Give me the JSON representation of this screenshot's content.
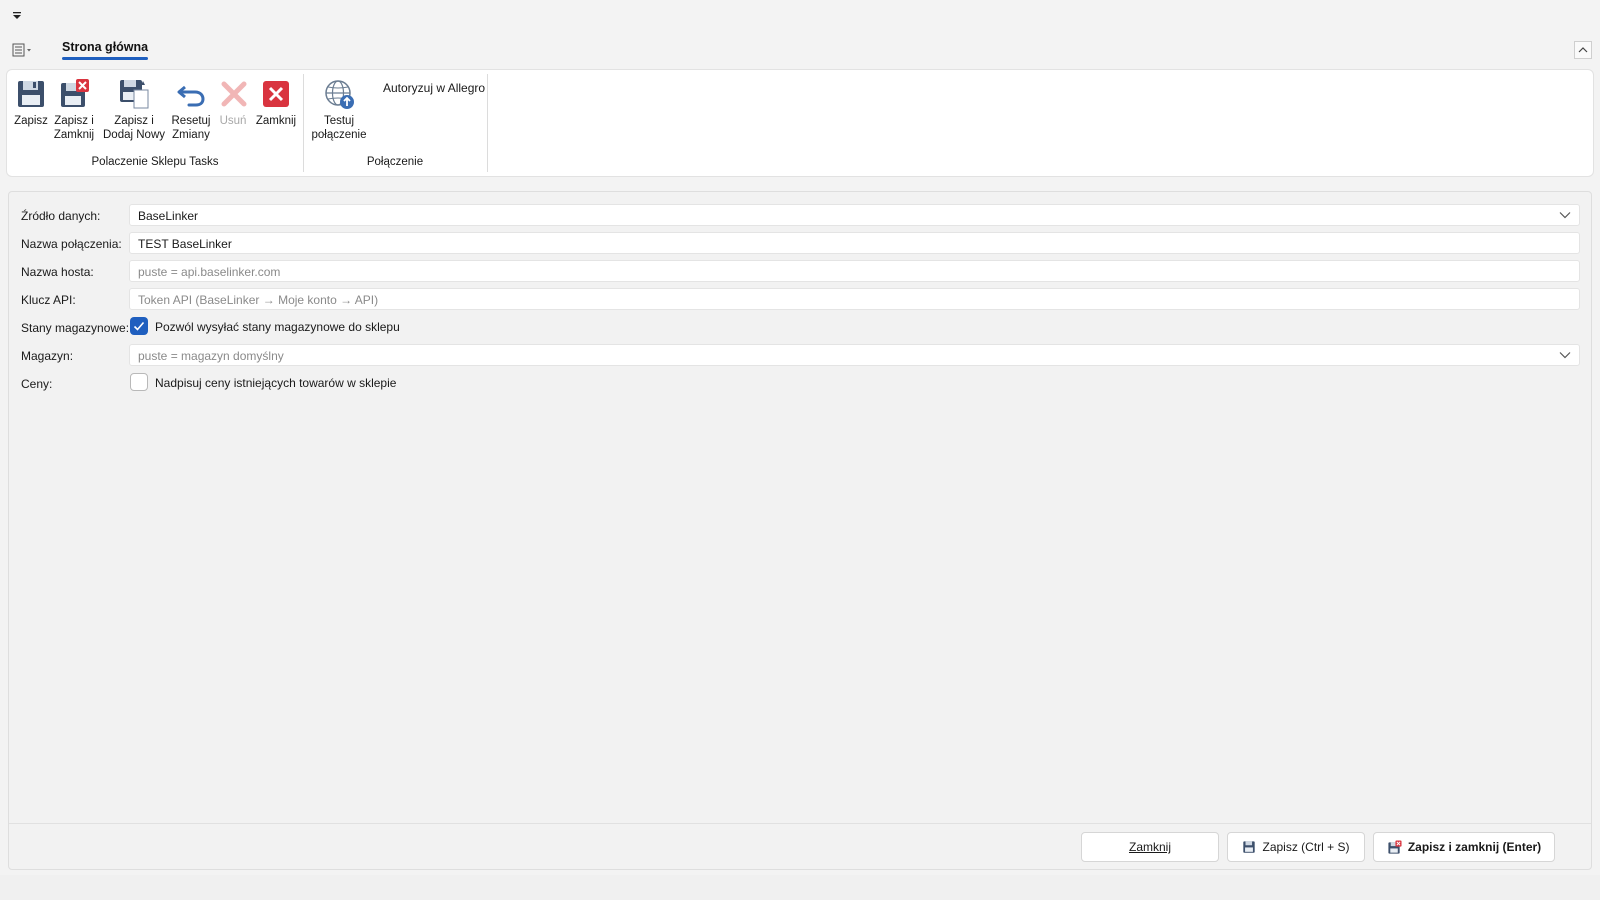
{
  "quick_access": {
    "icon": "dropdown-arrow-icon"
  },
  "ribbon": {
    "menu_icon": "list-menu-icon",
    "active_tab": "Strona główna",
    "groups": [
      {
        "label": "Polaczenie Sklepu Tasks",
        "buttons": [
          {
            "label": "Zapisz",
            "icon": "floppy-icon",
            "enabled": true
          },
          {
            "label": "Zapisz i\nZamknij",
            "icon": "floppy-close-icon",
            "enabled": true
          },
          {
            "label": "Zapisz i\nDodaj Nowy",
            "icon": "floppy-new-icon",
            "enabled": true
          },
          {
            "label": "Resetuj\nZmiany",
            "icon": "undo-icon",
            "enabled": true
          },
          {
            "label": "Usuń",
            "icon": "delete-x-icon",
            "enabled": false
          },
          {
            "label": "Zamknij",
            "icon": "close-red-icon",
            "enabled": true
          }
        ]
      },
      {
        "label": "Połączenie",
        "buttons": [
          {
            "label": "Testuj\npołączenie",
            "icon": "globe-upload-icon",
            "enabled": true
          }
        ],
        "link": "Autoryzuj w Allegro"
      }
    ]
  },
  "form": {
    "source": {
      "label": "Źródło danych:",
      "value": "BaseLinker"
    },
    "connection_name": {
      "label": "Nazwa połączenia:",
      "value": "TEST BaseLinker"
    },
    "host": {
      "label": "Nazwa hosta:",
      "placeholder": "puste = api.baselinker.com"
    },
    "api_key": {
      "label": "Klucz API:",
      "placeholder": "Token API (BaseLinker → Moje konto → API)"
    },
    "stock": {
      "label": "Stany magazynowe:",
      "checkbox_label": "Pozwól wysyłać stany magazynowe do sklepu",
      "checked": true
    },
    "warehouse": {
      "label": "Magazyn:",
      "placeholder": "puste = magazyn domyślny"
    },
    "prices": {
      "label": "Ceny:",
      "checkbox_label": "Nadpisuj ceny istniejących towarów w sklepie",
      "checked": false
    }
  },
  "footer": {
    "close_label": "Zamknij",
    "save_label": "Zapisz (Ctrl + S)",
    "save_close_label": "Zapisz i zamknij (Enter)"
  },
  "colors": {
    "accent": "#1f5fbf",
    "close_red": "#d9343f"
  }
}
